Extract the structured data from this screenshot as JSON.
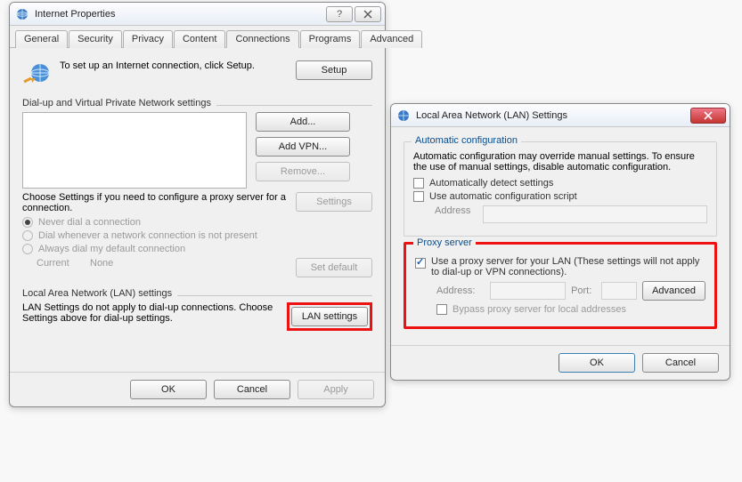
{
  "dialog1": {
    "title": "Internet Properties",
    "tabs": [
      "General",
      "Security",
      "Privacy",
      "Content",
      "Connections",
      "Programs",
      "Advanced"
    ],
    "active_tab": "Connections",
    "setup_text": "To set up an Internet connection, click Setup.",
    "setup_btn": "Setup",
    "dial_section": "Dial-up and Virtual Private Network settings",
    "add_btn": "Add...",
    "addvpn_btn": "Add VPN...",
    "remove_btn": "Remove...",
    "settings_btn": "Settings",
    "settings_text": "Choose Settings if you need to configure a proxy server for a connection.",
    "radio_never": "Never dial a connection",
    "radio_when": "Dial whenever a network connection is not present",
    "radio_always": "Always dial my default connection",
    "current_lbl": "Current",
    "current_val": "None",
    "setdefault_btn": "Set default",
    "lan_section": "Local Area Network (LAN) settings",
    "lan_text": "LAN Settings do not apply to dial-up connections. Choose Settings above for dial-up settings.",
    "lan_btn": "LAN settings",
    "ok": "OK",
    "cancel": "Cancel",
    "apply": "Apply"
  },
  "dialog2": {
    "title": "Local Area Network (LAN) Settings",
    "auto_title": "Automatic configuration",
    "auto_text": "Automatic configuration may override manual settings.  To ensure the use of manual settings, disable automatic configuration.",
    "auto_detect": "Automatically detect settings",
    "auto_script": "Use automatic configuration script",
    "address_lbl": "Address",
    "proxy_title": "Proxy server",
    "proxy_use": "Use a proxy server for your LAN (These settings will not apply to dial-up or VPN connections).",
    "port_lbl": "Port:",
    "advanced_btn": "Advanced",
    "bypass": "Bypass proxy server for local addresses",
    "ok": "OK",
    "cancel": "Cancel"
  }
}
